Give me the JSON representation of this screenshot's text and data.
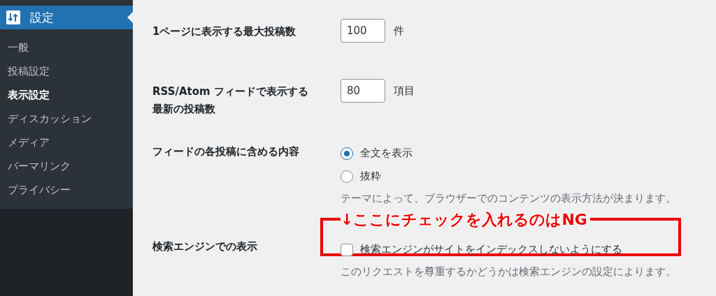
{
  "sidebar": {
    "header": {
      "label": "設定",
      "selected": true
    },
    "items": [
      {
        "label": "一般",
        "selected": false
      },
      {
        "label": "投稿設定",
        "selected": false
      },
      {
        "label": "表示設定",
        "selected": true
      },
      {
        "label": "ディスカッション",
        "selected": false
      },
      {
        "label": "メディア",
        "selected": false
      },
      {
        "label": "パーマリンク",
        "selected": false
      },
      {
        "label": "プライバシー",
        "selected": false
      }
    ]
  },
  "rows": [
    {
      "kind": "number",
      "label": "1ページに表示する最大投稿数",
      "value": "100",
      "unit": "件"
    },
    {
      "kind": "number",
      "label": "RSS/Atom フィードで表示する最新の投稿数",
      "value": "80",
      "unit": "項目"
    },
    {
      "kind": "radio",
      "label": "フィードの各投稿に含める内容",
      "options": [
        {
          "label": "全文を表示",
          "selected": true
        },
        {
          "label": "抜粋",
          "selected": false
        }
      ],
      "description": "テーマによって、ブラウザーでのコンテンツの表示方法が決まります。"
    },
    {
      "kind": "checkbox",
      "label": "検索エンジンでの表示",
      "option": "検索エンジンがサイトをインデックスしないようにする",
      "checked": false,
      "description": "このリクエストを尊重するかどうかは検索エンジンの設定によります。",
      "annotation": "↓ここにチェックを入れるのはNG"
    }
  ]
}
